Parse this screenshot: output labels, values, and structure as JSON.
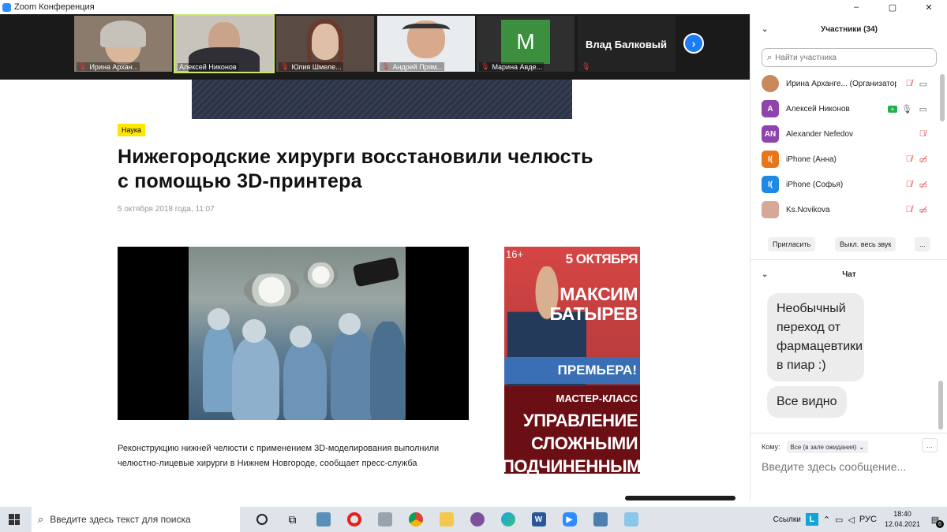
{
  "window": {
    "title": "Zoom Конференция",
    "controls": [
      "–",
      "▢",
      "✕"
    ]
  },
  "video_strip": {
    "tiles": [
      {
        "name": "Ирина Архан..."
      },
      {
        "name": "Алексей Никонов"
      },
      {
        "name": "Юлия Шмеле..."
      },
      {
        "name": "Андрей Прям..."
      },
      {
        "name": "Марина Авде...",
        "avatar_letter": "M"
      },
      {
        "name": "Влад Балковый"
      }
    ],
    "next_arrow": "›"
  },
  "article": {
    "tag": "Наука",
    "headline": "Нижегородские хирурги восстановили челюсть с помощью 3D-принтера",
    "date": "5 октября 2018 года, 11:07",
    "lead": "Реконструкцию нижней челюсти с применением 3D-моделирования выполнили челюстно-лицевые хирурги в Нижнем Новгороде, сообщает пресс-служба"
  },
  "ad": {
    "age": "16+",
    "date": "5 ОКТЯБРЯ",
    "name": "МАКСИМ БАТЫРЕВ",
    "premiere": "ПРЕМЬЕРА!",
    "masterclass": "МАСТЕР-КЛАСС",
    "title": "УПРАВЛЕНИЕ СЛОЖНЫМИ ПОДЧИНЕННЫМИ"
  },
  "participants": {
    "header": "Участники (34)",
    "search_placeholder": "Найти участника",
    "list": [
      {
        "name": "Ирина Архангe... (Организатор, я)",
        "avatar": "",
        "color": "#c9885c",
        "mic": "muted",
        "cam": "on"
      },
      {
        "name": "Алексей Никонов",
        "avatar": "A",
        "color": "#8e44ad",
        "mic": "on",
        "cam": "on",
        "sharing": true
      },
      {
        "name": "Alexander Nefedov",
        "avatar": "AN",
        "color": "#8e44ad",
        "mic": "muted",
        "cam": "none"
      },
      {
        "name": "iPhone (Анна)",
        "avatar": "I(",
        "color": "#e8761b",
        "mic": "muted",
        "cam": "off"
      },
      {
        "name": "iPhone (Софья)",
        "avatar": "I(",
        "color": "#1e88e5",
        "mic": "muted",
        "cam": "off"
      },
      {
        "name": "Ks.Novikova",
        "avatar": "",
        "color": "#d7a89a",
        "mic": "muted",
        "cam": "off"
      }
    ],
    "buttons": {
      "invite": "Пригласить",
      "mute_all": "Выкл. весь звук",
      "more": "..."
    }
  },
  "chat": {
    "header": "Чат",
    "messages": [
      "Необычный переход от фармацевтики в пиар :)",
      "Все видно"
    ],
    "to_label": "Кому:",
    "to_value": "Все (в зале ожидания)",
    "more": "...",
    "input_placeholder": "Введите здесь сообщение..."
  },
  "taskbar": {
    "search_placeholder": "Введите здесь текст для поиска",
    "tray": {
      "links": "Ссылки",
      "lang": "РУС",
      "time": "18:40",
      "date": "12.04.2021",
      "notifications": "6"
    }
  },
  "colors": {
    "zoom_blue": "#2d8cff",
    "muted_red": "#e53935",
    "tag_yellow": "#ffe600"
  }
}
